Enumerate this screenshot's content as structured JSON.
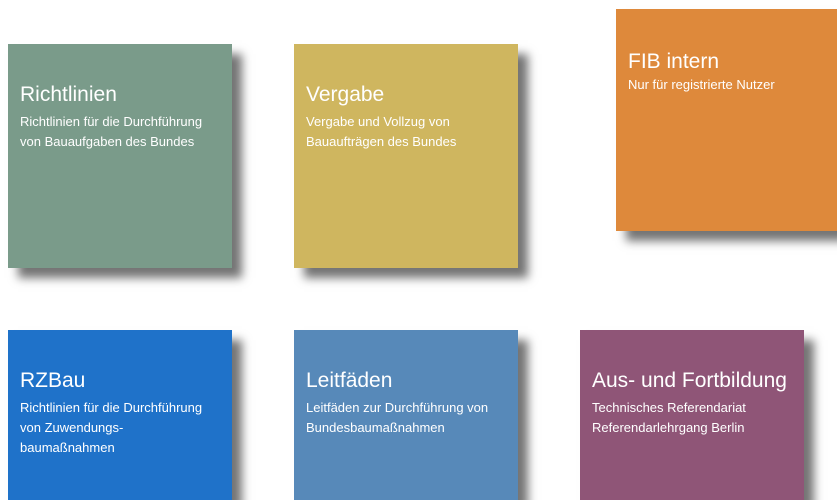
{
  "tiles": [
    {
      "title": "Richtlinien",
      "desc": "Richtlinien für die Durchführung\nvon Bauaufgaben des Bundes",
      "color": "#7a9b8a"
    },
    {
      "title": "Vergabe",
      "desc": "Vergabe und Vollzug von\nBauaufträgen des Bundes",
      "color": "#cfb65f"
    },
    {
      "title": "FIB intern",
      "desc": "Nur für registrierte Nutzer",
      "color": "#de893b"
    },
    {
      "title": "RZBau",
      "desc": "Richtlinien für die Durchführung\nvon Zuwendungs-\nbaumaßnahmen",
      "color": "#1f72c9"
    },
    {
      "title": "Leitfäden",
      "desc": "Leitfäden zur Durchführung von\nBundesbaumaßnahmen",
      "color": "#5789b9"
    },
    {
      "title": "Aus- und Fortbildung",
      "desc": "Technisches Referendariat\nReferendarlehrgang Berlin",
      "color": "#8f5577"
    }
  ]
}
